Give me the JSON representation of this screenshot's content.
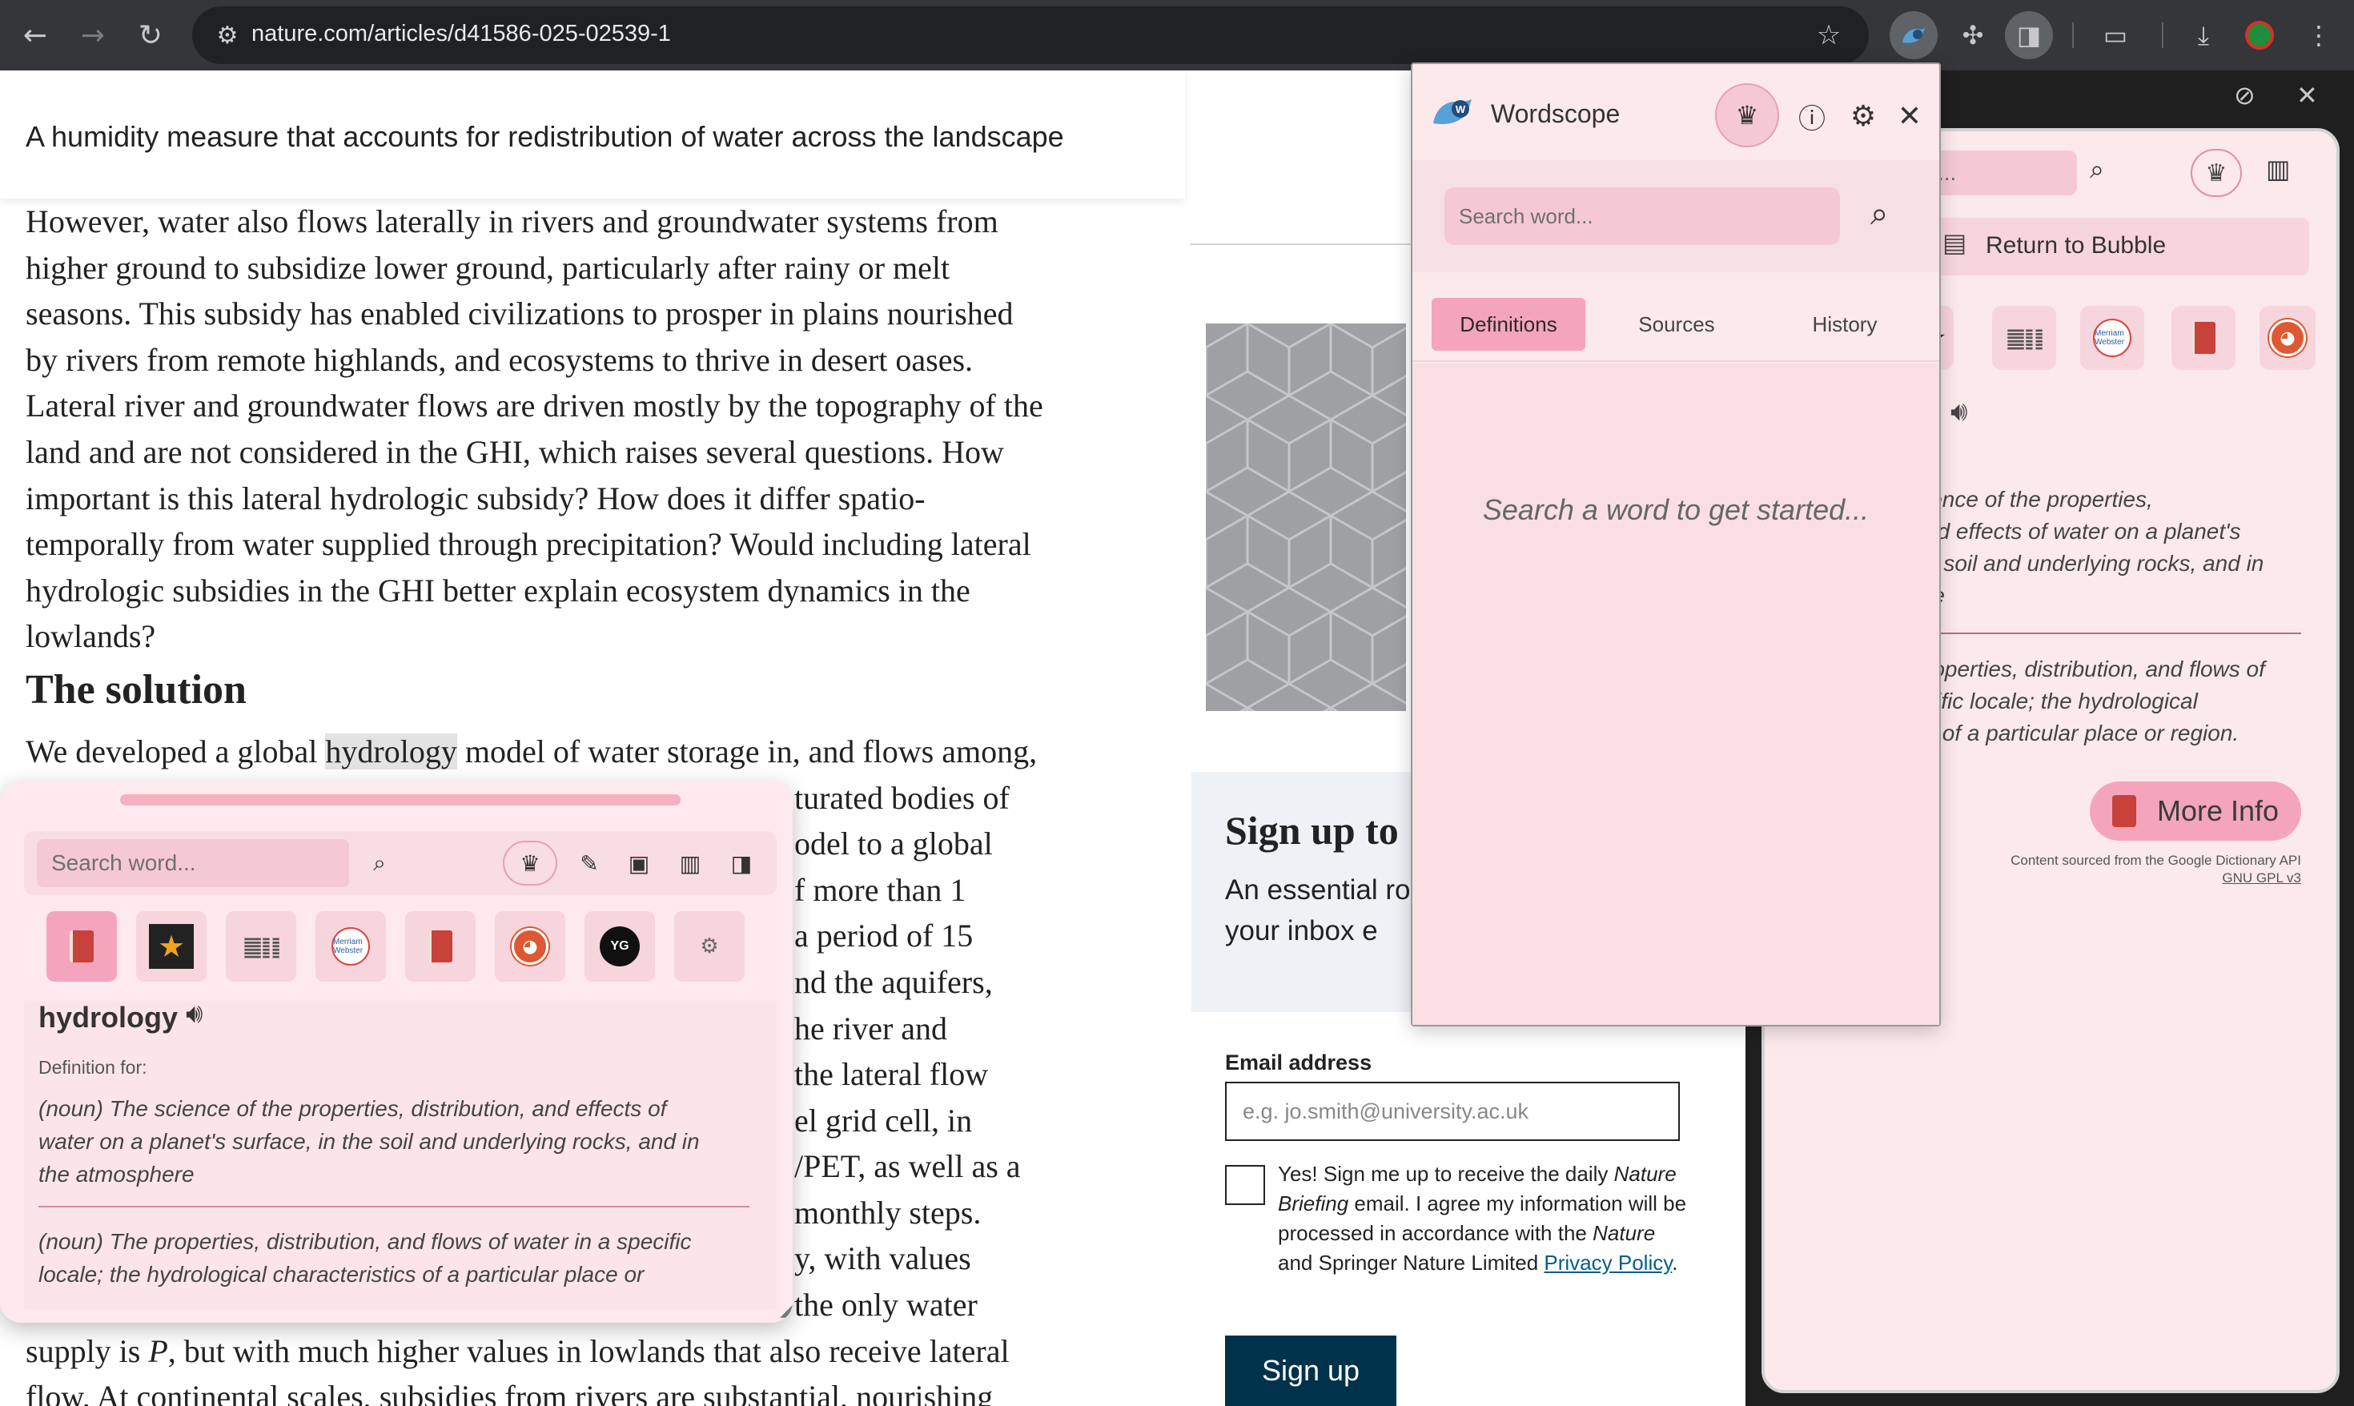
{
  "browser": {
    "url": "nature.com/articles/d41586-025-02539-1",
    "icons": {
      "back": "arrow-left-icon",
      "forward": "arrow-right-icon",
      "reload": "reload-icon",
      "site_info": "tune-icon",
      "bookmark": "star-icon",
      "wordscope_ext": "wordscope-extension-icon",
      "extensions": "puzzle-icon",
      "side_panel": "side-panel-icon",
      "cast": "cast-icon",
      "downloads": "download-icon",
      "profile": "profile-avatar-icon"
    }
  },
  "article": {
    "caption": "A humidity measure that accounts for redistribution of water across the landscape",
    "paragraph1": [
      "However, water also flows laterally in rivers and groundwater systems from",
      "higher ground to subsidize lower ground, particularly after rainy or melt",
      "seasons. This subsidy has enabled civilizations to prosper in plains nourished",
      "by rivers from remote highlands, and ecosystems to thrive in desert oases.",
      "Lateral river and groundwater flows are driven mostly by the topography of the",
      "land and are not considered in the GHI, which raises several questions. How",
      "important is this lateral hydrologic subsidy? How does it differ spatio-",
      "temporally from water supplied through precipitation? Would including lateral",
      "hydrologic subsidies in the GHI better explain ecosystem dynamics in the",
      "lowlands?"
    ],
    "heading": "The solution",
    "paragraph2_first_before": "We developed a global ",
    "paragraph2_highlight": "hydrology",
    "paragraph2_first_after": " model of water storage in, and flows among,",
    "paragraph2_fragments": [
      "turated bodies of",
      "odel to a global",
      "f more than 1",
      "a period of 15",
      "nd the aquifers,",
      "he river and",
      "the lateral flow",
      "el grid cell, in",
      "/PET, as well as a",
      "monthly steps.",
      "y, with values",
      "the only water"
    ],
    "paragraph2_tail": [
      "supply is P, but with much higher values in lowlands that also receive lateral",
      "flow. At continental scales, subsidies from rivers are substantial, nourishing"
    ]
  },
  "signup": {
    "title": "Sign up to",
    "description": "An essential ro news, opinion a to your inbox e",
    "email_label": "Email address",
    "email_placeholder": "e.g. jo.smith@university.ac.uk",
    "consent_prefix": "Yes! Sign me up to receive the daily ",
    "consent_italic": "Nature Briefing",
    "consent_middle": " email. I agree my information will be processed in accordance with the ",
    "consent_italic2": "Nature",
    "consent_mid2": " and Springer Nature Limited ",
    "consent_link": "Privacy Policy",
    "consent_suffix": ".",
    "button": "Sign up"
  },
  "wordscope_popup": {
    "title": "Wordscope",
    "search_placeholder": "Search word...",
    "tabs": [
      "Definitions",
      "Sources",
      "History"
    ],
    "active_tab": "Definitions",
    "empty_message": "Search a word to get started...",
    "icons": {
      "logo": "wordscope-logo-icon",
      "premium": "crown-icon",
      "info": "info-icon",
      "settings": "gear-icon",
      "close": "close-icon",
      "search": "search-icon"
    }
  },
  "side_panel": {
    "search_placeholder": "...",
    "return_label": "Return to Bubble",
    "definition1": [
      "ience of the properties,",
      "nd effects of water on a planet's",
      "e soil and underlying rocks, and in",
      "re"
    ],
    "definition2": [
      "roperties, distribution, and flows of",
      "cific locale; the hydrological",
      "s of a particular place or region."
    ],
    "more_info": "More Info",
    "source_line1": "Content sourced from the Google Dictionary API",
    "source_line2": "GNU GPL v3"
  },
  "bubble": {
    "search_placeholder": "Search word...",
    "word": "hydrology",
    "definition_for": "Definition for:",
    "definition1": [
      "(noun) The science of the properties, distribution, and effects of",
      "water on a planet's surface, in the soil and underlying rocks, and in",
      "the atmosphere"
    ],
    "definition2": [
      "(noun) The properties, distribution, and flows of water in a specific",
      "locale; the hydrological characteristics of a particular place or"
    ],
    "sources": [
      "google-dictionary-icon",
      "wordnik-star-icon",
      "chinese-glyphs-icon",
      "merriam-webster-icon",
      "red-book-icon",
      "duckduckgo-icon",
      "youglish-icon",
      "lingua-robot-icon"
    ],
    "yg_label": "YG",
    "mw_label": "Merriam Webster"
  },
  "colors": {
    "accent_pink": "#f4a5bb",
    "panel_bg": "#fbe9ec",
    "nature_blue": "#01324b",
    "chrome_dark": "#35363a"
  }
}
